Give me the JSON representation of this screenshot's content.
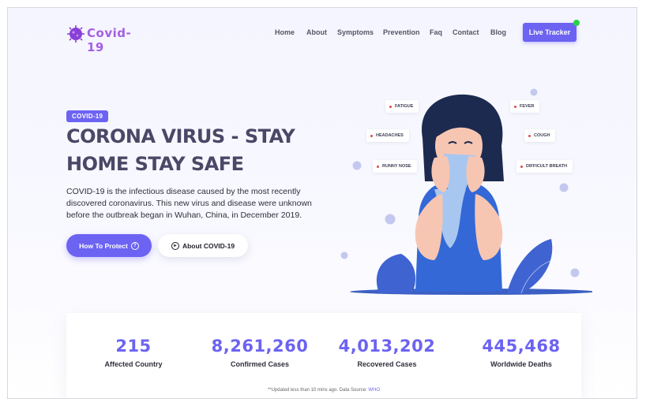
{
  "brand": {
    "logo_text": "Covid-19"
  },
  "nav": {
    "items": [
      "Home",
      "About",
      "Symptoms",
      "Prevention",
      "Faq",
      "Contact",
      "Blog"
    ],
    "cta": "Live Tracker"
  },
  "hero": {
    "badge": "COVID-19",
    "title_line1": "CORONA VIRUS - STAY",
    "title_line2": "HOME STAY SAFE",
    "description": "COVID-19 is the infectious disease caused by the most recently discovered coronavirus. This new virus and disease were unknown before the outbreak began in Wuhan, China, in December 2019.",
    "primary_button": "How To Protect",
    "secondary_button": "About COVID-19"
  },
  "symptoms": [
    "FATIGUE",
    "HEADACHES",
    "RUNNY NOSE",
    "FEVER",
    "COUGH",
    "DIFFICULT BREATH"
  ],
  "stats": [
    {
      "value": "215",
      "label": "Affected Country"
    },
    {
      "value": "8,261,260",
      "label": "Confirmed Cases"
    },
    {
      "value": "4,013,202",
      "label": "Recovered Cases"
    },
    {
      "value": "445,468",
      "label": "Worldwide Deaths"
    }
  ],
  "update_note": {
    "text": "**Updated less than 10 mins ago. Data Source: ",
    "source": "WHO"
  },
  "colors": {
    "accent": "#6c63f2",
    "live_dot": "#2bd14a",
    "title": "#4b4766"
  }
}
